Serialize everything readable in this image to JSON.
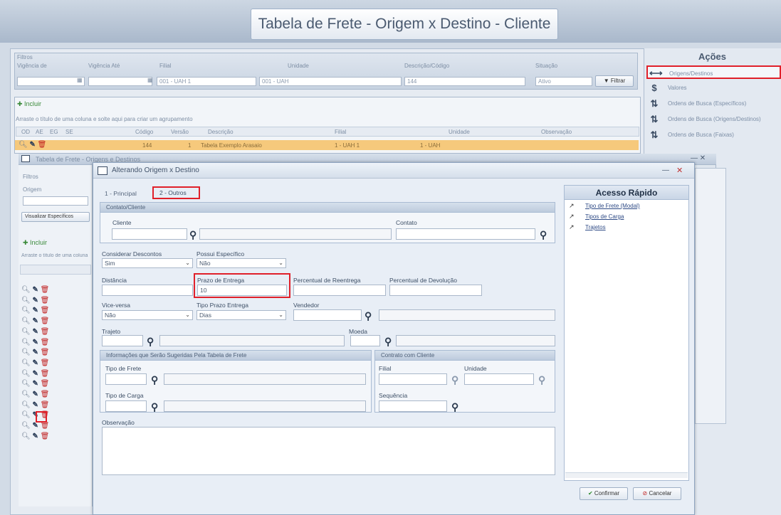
{
  "banner": {
    "title": "Tabela de Frete - Origem x Destino - Cliente"
  },
  "filters": {
    "label": "Filtros",
    "fields": [
      {
        "label": "Vigência de",
        "value": ""
      },
      {
        "label": "Vigência Até",
        "value": ""
      },
      {
        "label": "Filial",
        "value": "001 - UAH 1"
      },
      {
        "label": "Unidade",
        "value": "001 - UAH"
      },
      {
        "label": "Descrição/Código",
        "value": "144"
      },
      {
        "label": "Situação",
        "value": "Ativo"
      }
    ],
    "filter_button": "Filtrar"
  },
  "grid": {
    "incluir": "Incluir",
    "hint": "Arraste o título de uma coluna e solte aqui para criar um agrupamento",
    "headers": [
      "OD",
      "AE",
      "EG",
      "SE",
      "Código",
      "Versão",
      "Descrição",
      "Filial",
      "Unidade",
      "Observação"
    ],
    "selected_row": {
      "codigo": "144",
      "versao": "1",
      "descricao": "Tabela Exemplo Arasaio",
      "filial": "1 - UAH 1",
      "unidade": "1 - UAH"
    }
  },
  "acoes": {
    "title": "Ações",
    "items": [
      {
        "icon": "arrows-icon",
        "glyph": "⟷",
        "label": "Origens/Destinos"
      },
      {
        "icon": "dollar-icon",
        "glyph": "$",
        "label": "Valores"
      },
      {
        "icon": "sort-icon",
        "glyph": "⇅",
        "label": "Ordens de Busca (Específicos)"
      },
      {
        "icon": "sort-icon",
        "glyph": "⇅",
        "label": "Ordens de Busca (Origens/Destinos)"
      },
      {
        "icon": "sort-icon",
        "glyph": "⇅",
        "label": "Ordens de Busca (Faixas)"
      }
    ]
  },
  "second_window": {
    "title": "Tabela de Frete - Origens e Destinos",
    "filtros": "Filtros",
    "filter_field": "Origem",
    "view_button": "Visualizar Específicos",
    "incluir": "Incluir",
    "hint": "Arraste o título de uma coluna",
    "row_count": 15
  },
  "dialog": {
    "title": "Alterando Origem x Destino",
    "tabs": [
      "1 - Principal",
      "2 - Outros"
    ],
    "contato_section": "Contato/Cliente",
    "cliente_label": "Cliente",
    "cliente_value": "",
    "contato_label": "Contato",
    "contato_value": "",
    "considerar_descontos_label": "Considerar Descontos",
    "considerar_descontos_value": "Sim",
    "possui_especifico_label": "Possui Específico",
    "possui_especifico_value": "Não",
    "distancia_label": "Distância",
    "distancia_value": "",
    "prazo_entrega_label": "Prazo de Entrega",
    "prazo_entrega_value": "10",
    "percentual_reentrega_label": "Percentual de Reentrega",
    "percentual_devolucao_label": "Percentual de Devolução",
    "vice_versa_label": "Vice-versa",
    "vice_versa_value": "Não",
    "tipo_prazo_label": "Tipo Prazo Entrega",
    "tipo_prazo_value": "Dias",
    "vendedor_label": "Vendedor",
    "trajeto_label": "Trajeto",
    "moeda_label": "Moeda",
    "info_section": "Informações que Serão Sugeridas Pela Tabela de Frete",
    "tipo_frete_label": "Tipo de Frete",
    "tipo_carga_label": "Tipo de Carga",
    "contrato_section": "Contrato com Cliente",
    "filial_label": "Filial",
    "unidade_label": "Unidade",
    "sequencia_label": "Sequência",
    "observacao_label": "Observação",
    "confirm": "Confirmar",
    "cancel": "Cancelar"
  },
  "quick_access": {
    "title": "Acesso Rápido",
    "items": [
      "Tipo de Frete (Modal)",
      "Tipos de Carga",
      "Trajetos"
    ]
  },
  "colors": {
    "highlight_red": "#e0202a",
    "selected_row": "#f6c97c"
  }
}
